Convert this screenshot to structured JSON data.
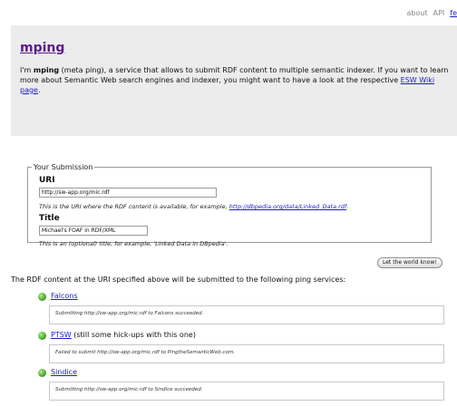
{
  "topnav": {
    "about": "about",
    "api": "API",
    "extra": "fe"
  },
  "header": {
    "logo": "mping",
    "intro_prefix": "I'm ",
    "intro_bold": "mping",
    "intro_text": " (meta ping), a service that allows to submit RDF content to multiple semantic indexer. If you want to learn more about Semantic Web search engines and indexer, you might want to have a look at the respective ",
    "intro_link": "ESW Wiki page",
    "intro_end": "."
  },
  "submission": {
    "legend": "Your Submission",
    "uri_label": "URI",
    "uri_value": "http://sw-app.org/mic.rdf",
    "uri_hint": "This is the URI where the RDF content is available, for example, ",
    "uri_hint_link": "http://dbpedia.org/data/Linked_Data.rdf",
    "uri_hint_end": ".",
    "title_label": "Title",
    "title_value": "Michael's FOAF in RDF/XML",
    "title_hint": "This is an (optional) title, for example, 'Linked Data in DBpedia'."
  },
  "submit_button": "Let the world know!",
  "services_intro": "The RDF content at the URI specified above will be submitted to the following ping services:",
  "services": [
    {
      "name": "Falcons",
      "note": "",
      "message": "Submitting http://sw-app.org/mic.rdf to Falcons succeeded."
    },
    {
      "name": "PTSW",
      "note": " (still some hick-ups with this one)",
      "message": "Failed to submit http://sw-app.org/mic.rdf to PingtheSemanticWeb.com."
    },
    {
      "name": "Sindice",
      "note": "",
      "message": "Submitting http://sw-app.org/mic.rdf to Sindice succeeded."
    }
  ]
}
